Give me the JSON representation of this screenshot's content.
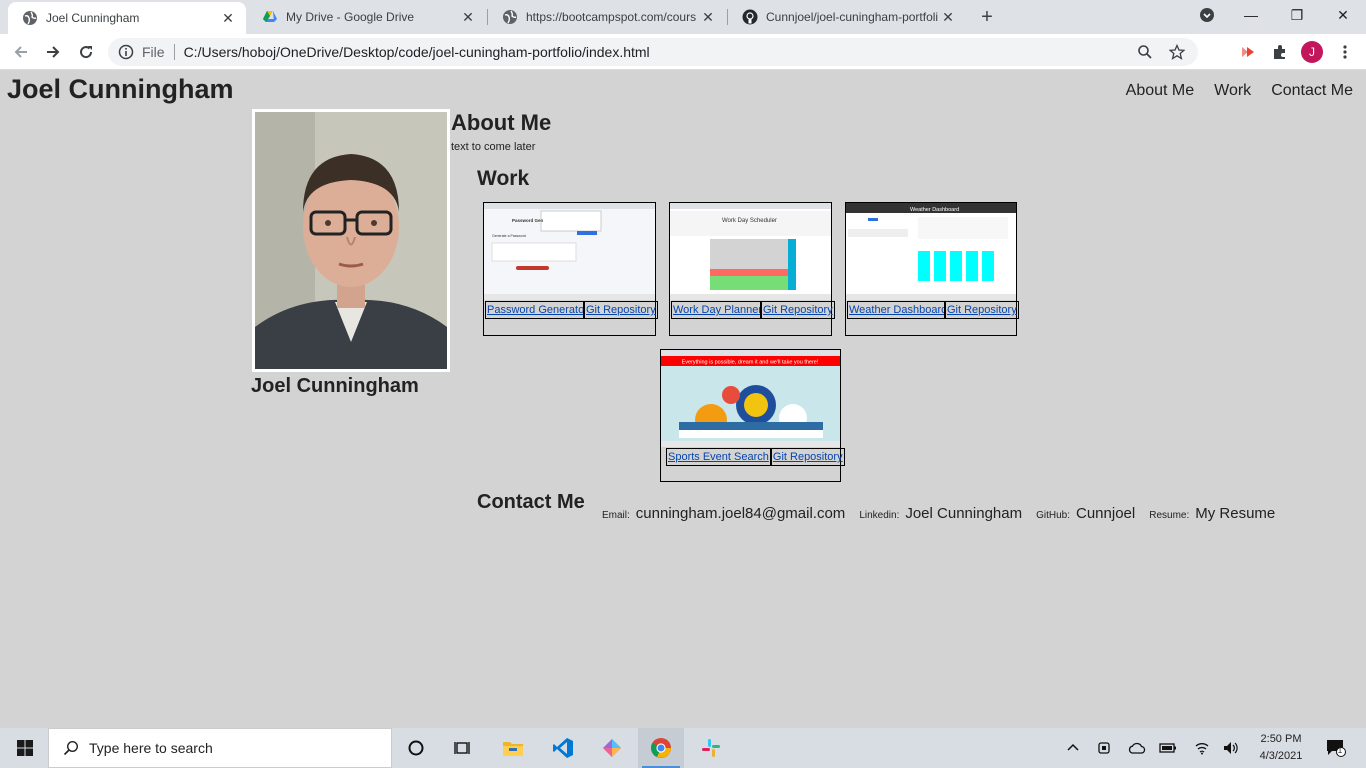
{
  "browser": {
    "tabs": [
      {
        "title": "Joel Cunningham",
        "icon": "globe-icon",
        "active": true
      },
      {
        "title": "My Drive - Google Drive",
        "icon": "google-drive-icon",
        "active": false
      },
      {
        "title": "https://bootcampspot.com/cours",
        "icon": "globe-icon",
        "active": false
      },
      {
        "title": "Cunnjoel/joel-cuningham-portfoli",
        "icon": "github-icon",
        "active": false
      }
    ],
    "scheme_label": "File",
    "url": "C:/Users/hoboj/OneDrive/Desktop/code/joel-cuningham-portfolio/index.html",
    "profile_initial": "J"
  },
  "page": {
    "site_name": "Joel Cunningham",
    "nav": [
      "About Me",
      "Work",
      "Contact Me"
    ],
    "photo_caption": "Joel Cunningham",
    "about": {
      "title": "About Me",
      "text": "text to come later"
    },
    "work": {
      "title": "Work",
      "projects": [
        {
          "name": "Password Generator",
          "repo": "Git Repository",
          "shot_heading": "Password Gen",
          "shot_sub": "Generate a Password"
        },
        {
          "name": "Work Day Planner",
          "repo": "Git Repository",
          "shot_heading": "Work Day Scheduler"
        },
        {
          "name": "Weather Dashboard",
          "repo": "Git Repository",
          "shot_heading": "Weather Dashboard"
        },
        {
          "name": "Sports Event Search",
          "repo": "Git Repository",
          "shot_heading": "Everything is possible, dream it and we'll take you there!"
        }
      ]
    },
    "contact": {
      "title": "Contact Me",
      "items": [
        {
          "label": "Email:",
          "value": "cunningham.joel84@gmail.com"
        },
        {
          "label": "Linkedin:",
          "value": "Joel Cunningham"
        },
        {
          "label": "GitHub:",
          "value": "Cunnjoel"
        },
        {
          "label": "Resume:",
          "value": "My Resume"
        }
      ]
    }
  },
  "taskbar": {
    "search_placeholder": "Type here to search",
    "time": "2:50 PM",
    "date": "4/3/2021",
    "notification_count": "1",
    "accent": "#4a90d9"
  }
}
